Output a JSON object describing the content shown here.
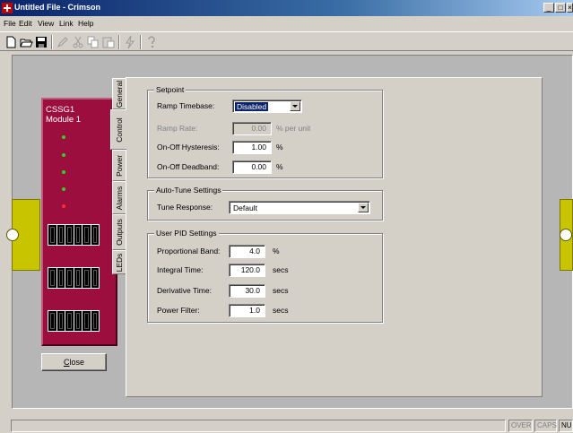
{
  "window": {
    "title": "Untitled File - Crimson"
  },
  "menu": [
    "File",
    "Edit",
    "View",
    "Link",
    "Help"
  ],
  "module": {
    "name": "CSSG1",
    "subtitle": "Module 1",
    "leds": [
      "green",
      "green",
      "green",
      "green",
      "red"
    ],
    "close_label": "Close"
  },
  "tabs": [
    "General",
    "Control",
    "Power",
    "Alarms",
    "Outputs",
    "LEDs"
  ],
  "active_tab": "Control",
  "setpoint": {
    "title": "Setpoint",
    "ramp_timebase_label": "Ramp Timebase:",
    "ramp_timebase_value": "Disabled",
    "ramp_rate_label": "Ramp Rate:",
    "ramp_rate_value": "0.00",
    "ramp_rate_unit": "% per unit",
    "hysteresis_label": "On-Off Hysteresis:",
    "hysteresis_value": "1.00",
    "hysteresis_unit": "%",
    "deadband_label": "On-Off Deadband:",
    "deadband_value": "0.00",
    "deadband_unit": "%"
  },
  "autotune": {
    "title": "Auto-Tune Settings",
    "response_label": "Tune Response:",
    "response_value": "Default"
  },
  "pid": {
    "title": "User PID Settings",
    "prop_band_label": "Proportional Band:",
    "prop_band_value": "4.0",
    "prop_band_unit": "%",
    "integral_label": "Integral Time:",
    "integral_value": "120.0",
    "integral_unit": "secs",
    "derivative_label": "Derivative Time:",
    "derivative_value": "30.0",
    "derivative_unit": "secs",
    "filter_label": "Power Filter:",
    "filter_value": "1.0",
    "filter_unit": "secs"
  },
  "status": {
    "over": "OVER",
    "caps": "CAPS",
    "num": "NUM"
  },
  "colors": {
    "module": "#9c0e3e",
    "rail": "#c8c400",
    "titlebar": "#0a246a"
  }
}
